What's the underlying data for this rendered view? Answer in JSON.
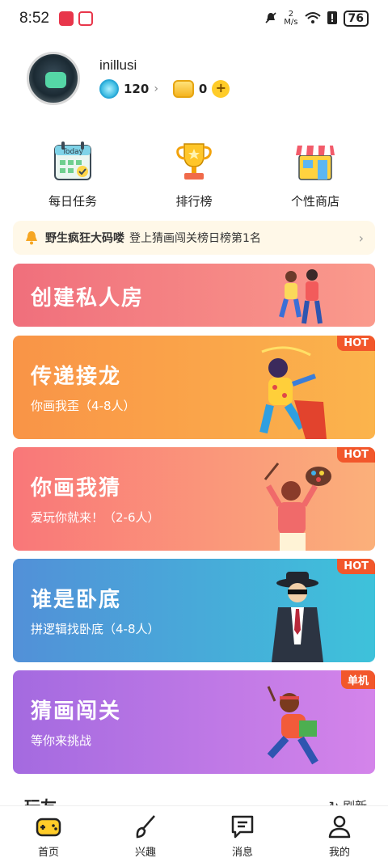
{
  "status_bar": {
    "time": "8:52",
    "net_speed_value": "2",
    "net_speed_unit": "M/s",
    "battery": "76"
  },
  "profile": {
    "username": "inillusi",
    "gems": "120",
    "coins": "0"
  },
  "tools": [
    {
      "label": "每日任务",
      "icon": "calendar-today-icon",
      "icon_text": "Today"
    },
    {
      "label": "排行榜",
      "icon": "trophy-icon"
    },
    {
      "label": "个性商店",
      "icon": "shop-icon"
    }
  ],
  "notice": {
    "user": "野生疯狂大码喽",
    "text": "登上猜画闯关榜日榜第1名"
  },
  "modes": [
    {
      "title": "创建私人房",
      "subtitle": "",
      "tag": ""
    },
    {
      "title": "传递接龙",
      "subtitle": "你画我歪（4-8人）",
      "tag": "HOT"
    },
    {
      "title": "你画我猜",
      "subtitle": "爱玩你就来！（2-6人）",
      "tag": "HOT"
    },
    {
      "title": "谁是卧底",
      "subtitle": "拼逻辑找卧底（4-8人）",
      "tag": "HOT"
    },
    {
      "title": "猜画闯关",
      "subtitle": "等你来挑战",
      "tag": "单机"
    }
  ],
  "friends_section": {
    "title": "玩友",
    "refresh": "刷新"
  },
  "bottom_nav": [
    {
      "label": "首页",
      "icon": "gamepad-icon",
      "active": true
    },
    {
      "label": "兴趣",
      "icon": "brush-icon",
      "active": false
    },
    {
      "label": "消息",
      "icon": "message-icon",
      "active": false
    },
    {
      "label": "我的",
      "icon": "profile-icon",
      "active": false
    }
  ],
  "colors": {
    "accent_yellow": "#ffcc29",
    "hot_tag": "#f2572b",
    "notice_bg": "#fff8e8"
  }
}
